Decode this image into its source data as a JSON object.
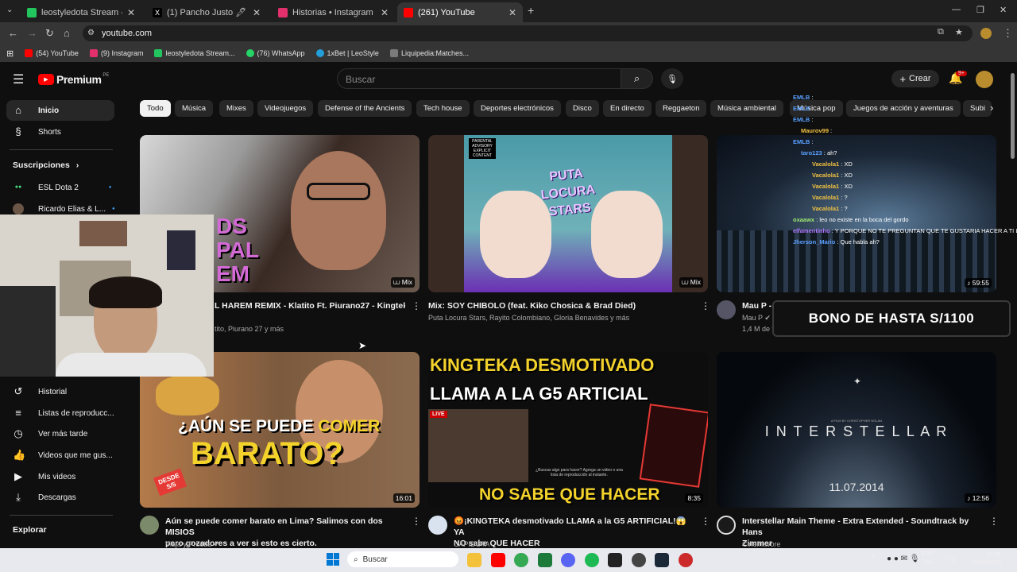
{
  "browser": {
    "tabs": [
      {
        "title": "leostyledota Stream - Watch Liv",
        "color": "#22c55e"
      },
      {
        "title": "(1) Pancho Justo 🖊 (@justopa",
        "color": "#444444"
      },
      {
        "title": "Historias • Instagram",
        "color": "#e1306c"
      },
      {
        "title": "(261) YouTube",
        "color": "#ff0000"
      }
    ],
    "url": "youtube.com",
    "bookmarks": [
      "(54) YouTube",
      "(9) Instagram",
      "leostyledota Stream...",
      "(76) WhatsApp",
      "1xBet | LeoStyle",
      "Liquipedia:Matches..."
    ]
  },
  "youtube": {
    "logo": "Premium",
    "logo_region": "PE",
    "search_placeholder": "Buscar",
    "create_label": "Crear",
    "notif_badge": "9+",
    "chips": [
      "Todo",
      "Música",
      "Mixes",
      "Videojuegos",
      "Defense of the Ancients",
      "Tech house",
      "Deportes electrónicos",
      "Disco",
      "En directo",
      "Reggaeton",
      "Música ambiental",
      "Música pop",
      "Juegos de acción y aventuras",
      "Subi"
    ],
    "sidebar": {
      "top": [
        "Inicio",
        "Shorts"
      ],
      "subs_header": "Suscripciones",
      "subs": [
        "ESL Dota 2",
        "Ricardo Elias & L..."
      ],
      "you": [
        "Historial",
        "Listas de reproducc...",
        "Ver más tarde",
        "Videos que me gus...",
        "Mis videos",
        "Descargas"
      ],
      "explore": "Explorar"
    },
    "videos": [
      {
        "title": "L HAREM REMIX - Klatito Ft. Piurano27 - Kingteka",
        "meta": "tito, Piurano 27 y más",
        "badge": "Mix",
        "thumb_text": "DS PAL EM"
      },
      {
        "title": "Mix: SOY CHIBOLO (feat. Kiko Chosica & Brad Died)",
        "meta": "Puta Locura Stars, Rayito Colombiano, Gloria Benavides y más",
        "badge": "Mix",
        "thumb_text": "PUTA LOCURA STARS",
        "advisory": "PARENTAL ADVISORY EXPLICIT CONTENT"
      },
      {
        "title": "Mau P - L",
        "meta1": "Mau P",
        "meta2": "1,4 M de v",
        "duration": "59:55"
      },
      {
        "title1": "Aún se puede comer barato  en Lima? Salimos con dos MISIOS",
        "title2": "pero gozadores a ver si esto es cierto.",
        "meta": "Viaja y Prueba",
        "duration": "16:01",
        "thumb_line1": "¿AÚN SE PUEDE",
        "thumb_word": "COMER",
        "thumb_line2": "BARATO?",
        "thumb_tag": "DESDE S/5"
      },
      {
        "title1": "😡¡KINGTEKA desmotivado LLAMA a la G5 ARTIFICIAL!😱 YA",
        "title2": "NO sabe QUE HACER",
        "meta": "CAPIDOTA",
        "duration": "8:35",
        "thumb_top1": "KINGTEKA DESMOTIVADO",
        "thumb_top2": "LLAMA A LA G5 ARTICIAL",
        "thumb_bottom": "NO SABE QUE HACER",
        "live": "LIVE",
        "dialog": "¿Buscas algo para hacer? Agrega un video o una lista de reproducción al instante."
      },
      {
        "title1": "Interstellar Main Theme - Extra Extended - Soundtrack by  Hans",
        "title2": "Zimmer",
        "meta": "Cinémavore",
        "duration": "12:56",
        "thumb_title": "I N T E R S T E L L A R",
        "thumb_date": "11.07.2014",
        "thumb_credit": "A FILM BY CHRISTOPHER NOLAN"
      }
    ]
  },
  "chat": [
    {
      "user": "EMLB",
      "msg": ":"
    },
    {
      "user": "EMLB",
      "msg": ":"
    },
    {
      "user": "EMLB",
      "msg": ":"
    },
    {
      "user": "Maurov99",
      "msg": ":"
    },
    {
      "user": "EMLB",
      "msg": ":"
    },
    {
      "user": "taro123",
      "msg": ": ah?"
    },
    {
      "user": "Vacalola1",
      "msg": ": XD"
    },
    {
      "user": "Vacalola1",
      "msg": ": XD"
    },
    {
      "user": "Vacalola1",
      "msg": ": XD"
    },
    {
      "user": "Vacalola1",
      "msg": ": ?"
    },
    {
      "user": "Vacalola1",
      "msg": ": ?"
    },
    {
      "user": "oxaawx",
      "msg": ": leo no existe en la boca del gordo"
    },
    {
      "user": "elfamentinho",
      "msg": ": Y PORQUE NO TE PREGUNTAN QUE TE GUSTARIA HACER A TI LEO"
    },
    {
      "user": "Jherson_Mario",
      "msg": ": Que habla ah?"
    }
  ],
  "promo_banner": "BONO DE HASTA S/1100",
  "taskbar": {
    "search": "Buscar",
    "lang1": "ESP",
    "lang2": "LAA",
    "time": "17:25",
    "date": "19/03/2026"
  },
  "colors": {
    "yt_red": "#ff0000",
    "bg": "#0f0f0f",
    "chip": "#272727",
    "live_red": "#cc0000"
  }
}
